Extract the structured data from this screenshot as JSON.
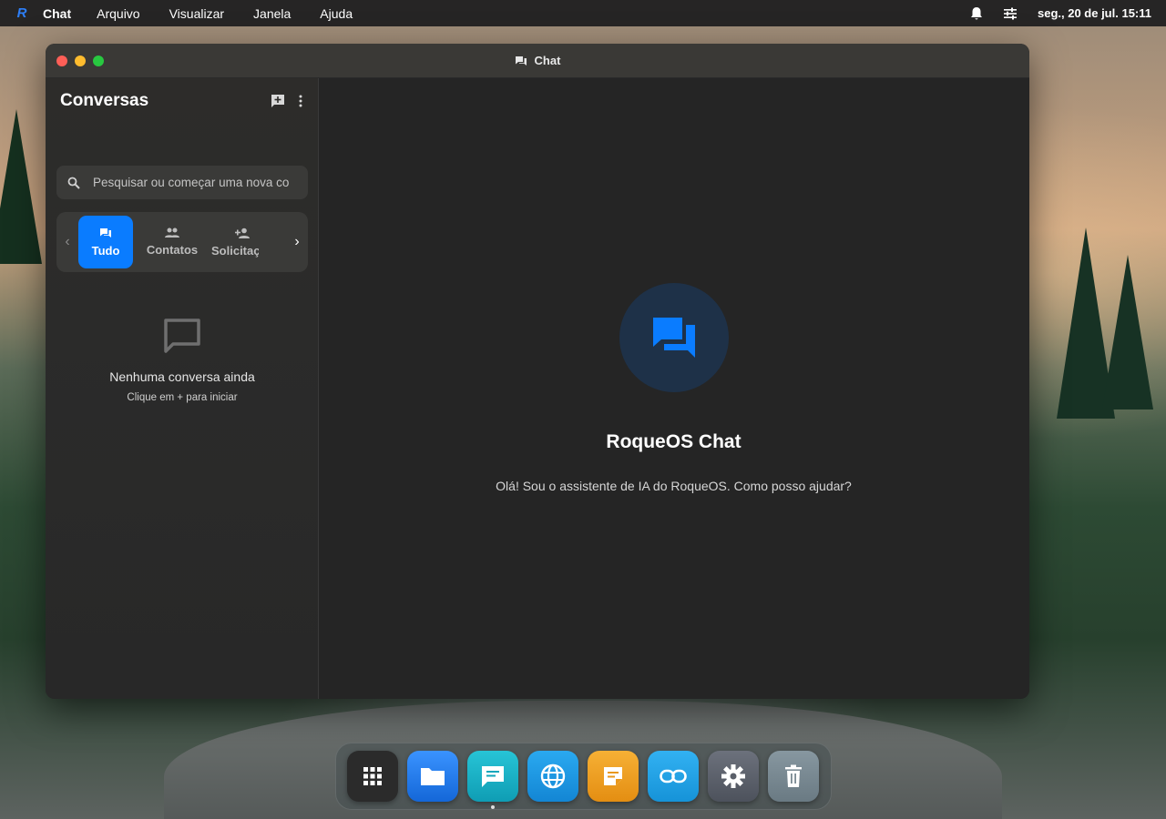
{
  "menubar": {
    "logo_icon": "roqueos-logo-icon",
    "app_name": "Chat",
    "menus": [
      "Arquivo",
      "Visualizar",
      "Janela",
      "Ajuda"
    ],
    "clock": "seg., 20 de jul. 15:11",
    "right_icons": [
      "bell-icon",
      "sliders-icon"
    ]
  },
  "window": {
    "title": "Chat",
    "title_icon": "chat-bubbles-icon"
  },
  "sidebar": {
    "title": "Conversas",
    "actions": [
      "new-chat-icon",
      "more-vertical-icon"
    ],
    "search": {
      "placeholder": "Pesquisar ou começar uma nova co",
      "value": ""
    },
    "tabs": [
      {
        "label": "Tudo",
        "icon": "chat-bubbles-icon",
        "active": true
      },
      {
        "label": "Contatos",
        "icon": "people-icon",
        "active": false
      },
      {
        "label": "Solicitaç",
        "icon": "person-add-icon",
        "active": false
      }
    ],
    "empty_state": {
      "icon": "message-outline-icon",
      "title": "Nenhuma conversa ainda",
      "subtitle": "Clique em + para iniciar"
    }
  },
  "main": {
    "hero_icon": "forum-icon",
    "title": "RoqueOS Chat",
    "subtitle": "Olá! Sou o assistente de IA do RoqueOS. Como posso ajudar?"
  },
  "dock": {
    "apps": [
      {
        "name": "app-grid-icon",
        "color": "#2b2b2b",
        "running": false
      },
      {
        "name": "folder-icon",
        "color": "#1e7df2",
        "running": false
      },
      {
        "name": "chat-icon",
        "color": "#19b4c8",
        "running": true
      },
      {
        "name": "globe-icon",
        "color": "#1a9be6",
        "running": false
      },
      {
        "name": "notes-icon",
        "color": "#f0a020",
        "running": false
      },
      {
        "name": "link-icon",
        "color": "#24a3e8",
        "running": false
      },
      {
        "name": "gear-icon",
        "color": "#5f6470",
        "running": false
      },
      {
        "name": "trash-icon",
        "color": "#7a8a92",
        "running": false
      }
    ]
  },
  "colors": {
    "accent": "#0a7cff",
    "window_bg": "#252525",
    "sidebar_bg": "#2c2b29"
  }
}
